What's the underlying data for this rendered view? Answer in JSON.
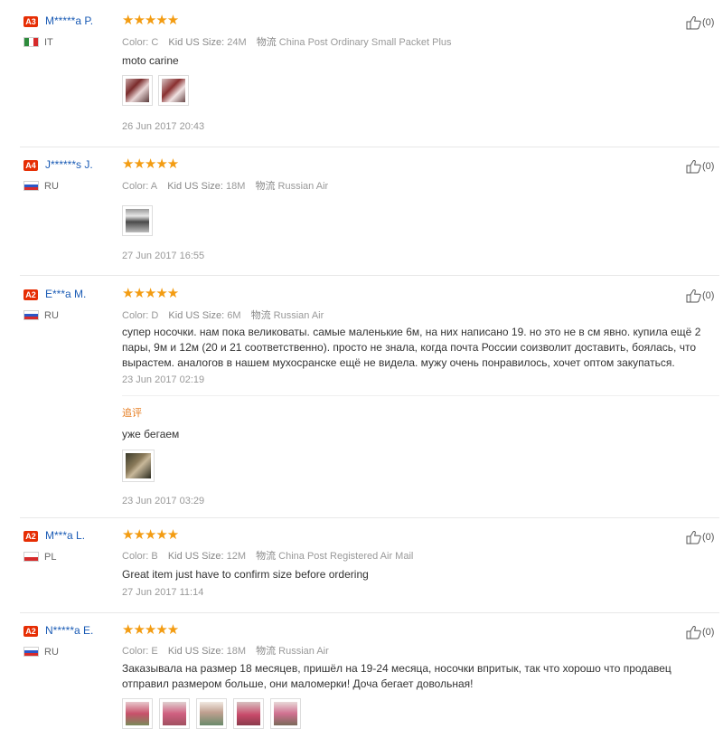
{
  "labels": {
    "color": "Color:",
    "size": "Kid US Size:",
    "shipping": "物流",
    "followup": "追评"
  },
  "colors": {
    "accent": "#e62e04",
    "star": "#f39c12",
    "link": "#1a5bb5",
    "followup": "#e67e22"
  },
  "reviews": [
    {
      "badge": "A3",
      "name": "M*****a P.",
      "country": "IT",
      "stars": "★★★★★",
      "color_value": "C",
      "size_value": "24M",
      "shipping_value": "China Post Ordinary Small Packet Plus",
      "text": "moto carine",
      "date": "26 Jun 2017 20:43",
      "likes": "(0)"
    },
    {
      "badge": "A4",
      "name": "J******s J.",
      "country": "RU",
      "stars": "★★★★★",
      "color_value": "A",
      "size_value": "18M",
      "shipping_value": "Russian Air",
      "text": "",
      "date": "27 Jun 2017 16:55",
      "likes": "(0)"
    },
    {
      "badge": "A2",
      "name": "E***a M.",
      "country": "RU",
      "stars": "★★★★★",
      "color_value": "D",
      "size_value": "6M",
      "shipping_value": "Russian Air",
      "text": "супер носочки. нам пока великоваты. самые маленькие 6м, на них написано 19. но это не в см явно. купила ещё 2 пары, 9м и 12м (20 и 21 соответственно). просто не знала, когда почта России соизволит доставить, боялась, что вырастем. аналогов в нашем мухосранске ещё не видела. мужу очень понравилось, хочет оптом закупаться.",
      "date": "23 Jun 2017 02:19",
      "followup_text": "уже бегаем",
      "followup_date": "23 Jun 2017 03:29",
      "likes": "(0)"
    },
    {
      "badge": "A2",
      "name": "M***a L.",
      "country": "PL",
      "stars": "★★★★★",
      "color_value": "B",
      "size_value": "12M",
      "shipping_value": "China Post Registered Air Mail",
      "text": "Great item just have to confirm size before ordering",
      "date": "27 Jun 2017 11:14",
      "likes": "(0)"
    },
    {
      "badge": "A2",
      "name": "N*****a E.",
      "country": "RU",
      "stars": "★★★★★",
      "color_value": "E",
      "size_value": "18M",
      "shipping_value": "Russian Air",
      "text": "Заказывала на размер 18 месяцев, пришёл на 19-24 месяца, носочки впритык, так что хорошо что продавец отправил размером больше, они маломерки! Доча бегает довольная!",
      "date": "",
      "likes": "(0)"
    }
  ]
}
